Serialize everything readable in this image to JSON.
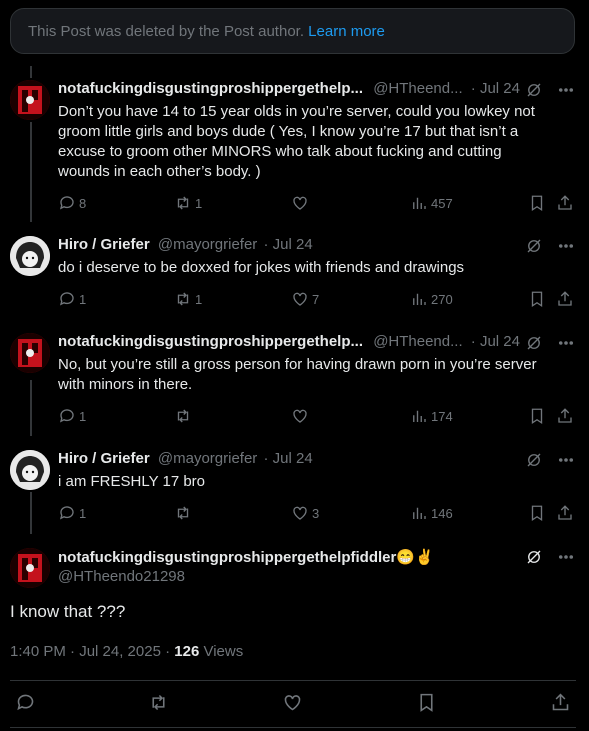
{
  "deleted_notice": {
    "text": "This Post was deleted by the Post author.",
    "link": "Learn more"
  },
  "tweets": [
    {
      "name": "notafuckingdisgustingproshippergethelp...",
      "handle": "@HTheend...",
      "date": "· Jul 24",
      "body": "Don’t you have 14 to 15 year olds in you’re server, could you lowkey not groom little girls and boys dude ( Yes, I know you’re 17 but that isn’t a excuse to groom other   MINORS who talk about fucking and cutting wounds in each other’s body. )",
      "replies": "8",
      "reposts": "1",
      "likes": "",
      "views": "457"
    },
    {
      "name": "Hiro / Griefer",
      "handle": "@mayorgriefer",
      "date": "· Jul 24",
      "body": "do i deserve to be doxxed for jokes with friends and drawings",
      "replies": "1",
      "reposts": "1",
      "likes": "7",
      "views": "270"
    },
    {
      "name": "notafuckingdisgustingproshippergethelp...",
      "handle": "@HTheend...",
      "date": "· Jul 24",
      "body": "No, but you’re still a gross person for having drawn porn in you’re server with minors in there.",
      "replies": "1",
      "reposts": "",
      "likes": "",
      "views": "174"
    },
    {
      "name": "Hiro / Griefer",
      "handle": "@mayorgriefer",
      "date": "· Jul 24",
      "body": "i am FRESHLY 17 bro",
      "replies": "1",
      "reposts": "",
      "likes": "3",
      "views": "146"
    }
  ],
  "main_post": {
    "name": "notafuckingdisgustingproshippergethelpfiddler",
    "emoji": "😁✌️",
    "handle": "@HTheendo21298",
    "text": "I know that ???",
    "time": "1:40 PM · Jul 24, 2025 · ",
    "views_count": "126",
    "views_label": " Views"
  },
  "colors": {
    "accent": "#1d9bf0",
    "muted": "#71767b",
    "text": "#e7e9ea",
    "border": "#2f3336"
  }
}
